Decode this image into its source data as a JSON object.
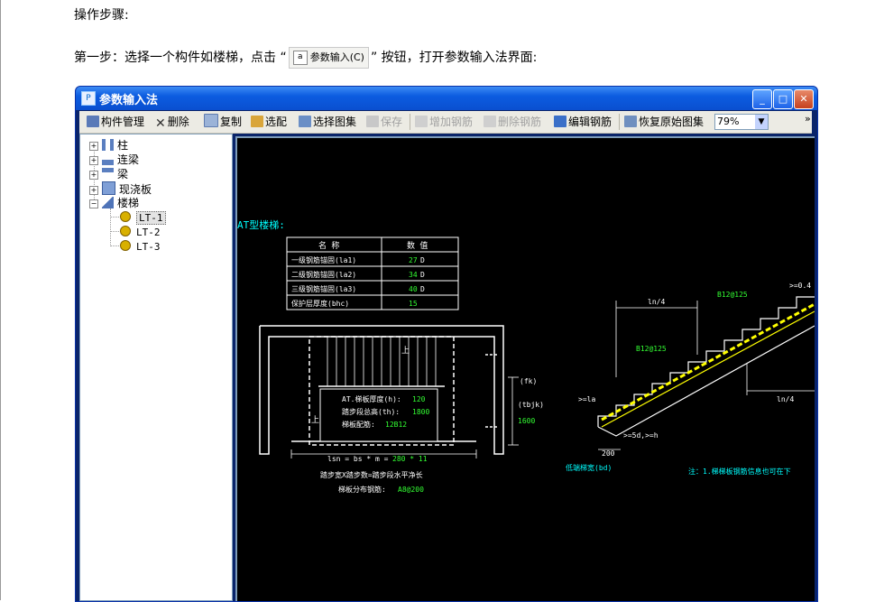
{
  "doc": {
    "heading": "操作步骤:",
    "step_prefix": "第一步：选择一个构件如楼梯，点击 “",
    "inline_button_label": "参数输入(C)",
    "step_suffix": "” 按钮，打开参数输入法界面:"
  },
  "window": {
    "title": "参数输入法",
    "controls": {
      "minimize": "_",
      "maximize": "□",
      "close": "✕"
    }
  },
  "toolbar": {
    "items": [
      {
        "label": "构件管理",
        "icon": "component-manage-icon",
        "enabled": true
      },
      {
        "label": "删除",
        "icon": "delete-icon",
        "enabled": true
      },
      {
        "label": "复制",
        "icon": "copy-icon",
        "enabled": true
      },
      {
        "label": "选配",
        "icon": "select-config-icon",
        "enabled": true
      },
      {
        "label": "选择图集",
        "icon": "atlas-icon",
        "enabled": true
      },
      {
        "label": "保存",
        "icon": "save-icon",
        "enabled": false
      },
      {
        "label": "增加钢筋",
        "icon": "add-rebar-icon",
        "enabled": false
      },
      {
        "label": "删除钢筋",
        "icon": "delete-rebar-icon",
        "enabled": false
      },
      {
        "label": "编辑钢筋",
        "icon": "edit-rebar-icon",
        "enabled": true
      },
      {
        "label": "恢复原始图集",
        "icon": "restore-icon",
        "enabled": true
      }
    ],
    "zoom_value": "79%",
    "more": "»"
  },
  "tree": {
    "nodes": [
      {
        "label": "柱",
        "expander": "+"
      },
      {
        "label": "连梁",
        "expander": "+"
      },
      {
        "label": "梁",
        "expander": "+"
      },
      {
        "label": "现浇板",
        "expander": "+"
      },
      {
        "label": "楼梯",
        "expander": "−"
      }
    ],
    "children": [
      {
        "label": "LT-1",
        "selected": true
      },
      {
        "label": "LT-2",
        "selected": false
      },
      {
        "label": "LT-3",
        "selected": false
      }
    ]
  },
  "drawing": {
    "title": "AT型楼梯:",
    "table_headers": [
      "名    称",
      "数  值"
    ],
    "table_rows": [
      {
        "name": "一级钢筋锚固(la1)",
        "value": "27",
        "unit": "D"
      },
      {
        "name": "二级钢筋锚固(la2)",
        "value": "34",
        "unit": "D"
      },
      {
        "name": "三级钢筋锚固(la3)",
        "value": "40",
        "unit": "D"
      },
      {
        "name": "保护层厚度(bhc)",
        "value": "15",
        "unit": ""
      }
    ],
    "plan_labels": {
      "up1": "上",
      "up2": "上",
      "thickness": "AT.梯板厚度(h):",
      "thickness_value": "120",
      "total_height": "踏步段总高(th):",
      "total_height_value": "1800",
      "reinforce": "梯板配筋:",
      "reinforce_value": "12B12",
      "fk": "(fk)",
      "tbjk": "(tbjk)",
      "h1600": "1600",
      "lsn": "lsn = bs * m = ",
      "lsn_values": "280 * 11",
      "formula": "踏步宽X踏步数=踏步段水平净长",
      "dist_bar": "梯板分布钢筋:",
      "dist_bar_value": "A8@200"
    },
    "section_labels": {
      "ln4_top": "ln/4",
      "ln4_bottom": "ln/4",
      "b12_top": "B12@125",
      "b12_mid": "B12@125",
      "ge_04": ">=0.4",
      "ge_la": ">=la",
      "ge_5d": ">=5d,>=h",
      "dim200": "200",
      "low_width": "低端梯宽(bd)",
      "note": "注：1.梯梯板钢筋信息也可在下"
    }
  }
}
